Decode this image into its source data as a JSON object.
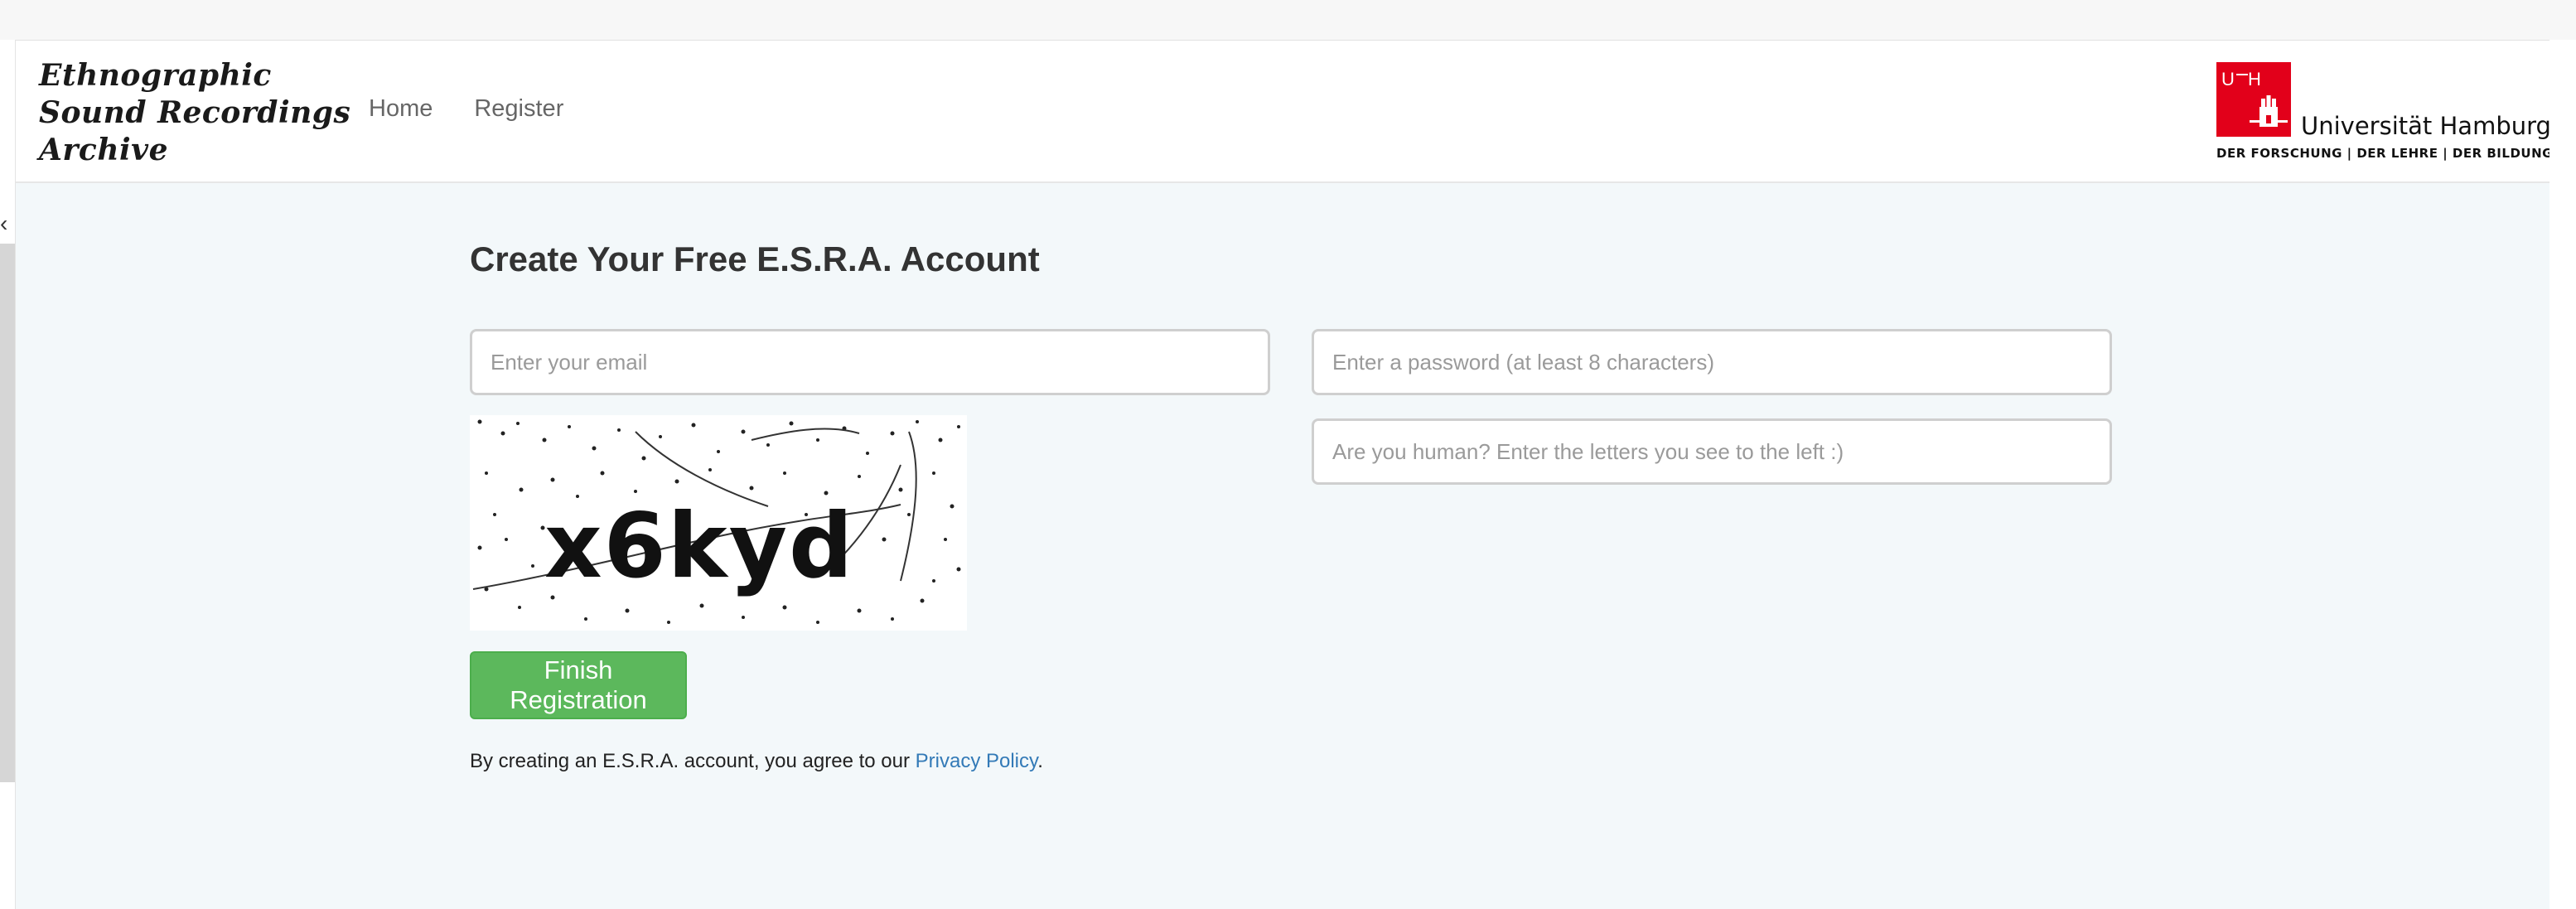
{
  "brand": {
    "line1": "Ethnographic",
    "line2": "Sound Recordings",
    "line3": "Archive"
  },
  "nav": {
    "home": "Home",
    "register": "Register"
  },
  "logo": {
    "box_text": "U H H",
    "name": "Universität Hamburg",
    "motto": "DER FORSCHUNG | DER LEHRE | DER BILDUNG"
  },
  "form": {
    "title": "Create Your Free E.S.R.A. Account",
    "email_placeholder": "Enter your email",
    "password_placeholder": "Enter a password (at least 8 characters)",
    "captcha_placeholder": "Are you human? Enter the letters you see to the left :)",
    "captcha_text": "x6kyd",
    "submit_label": "Finish Registration",
    "agree_prefix": "By creating an E.S.R.A. account, you agree to our ",
    "privacy_link": "Privacy Policy",
    "agree_suffix": "."
  },
  "colors": {
    "accent_green": "#5cb85c",
    "link_blue": "#337ab7",
    "uhh_red": "#e2001a",
    "content_bg": "#f3f8fa"
  }
}
